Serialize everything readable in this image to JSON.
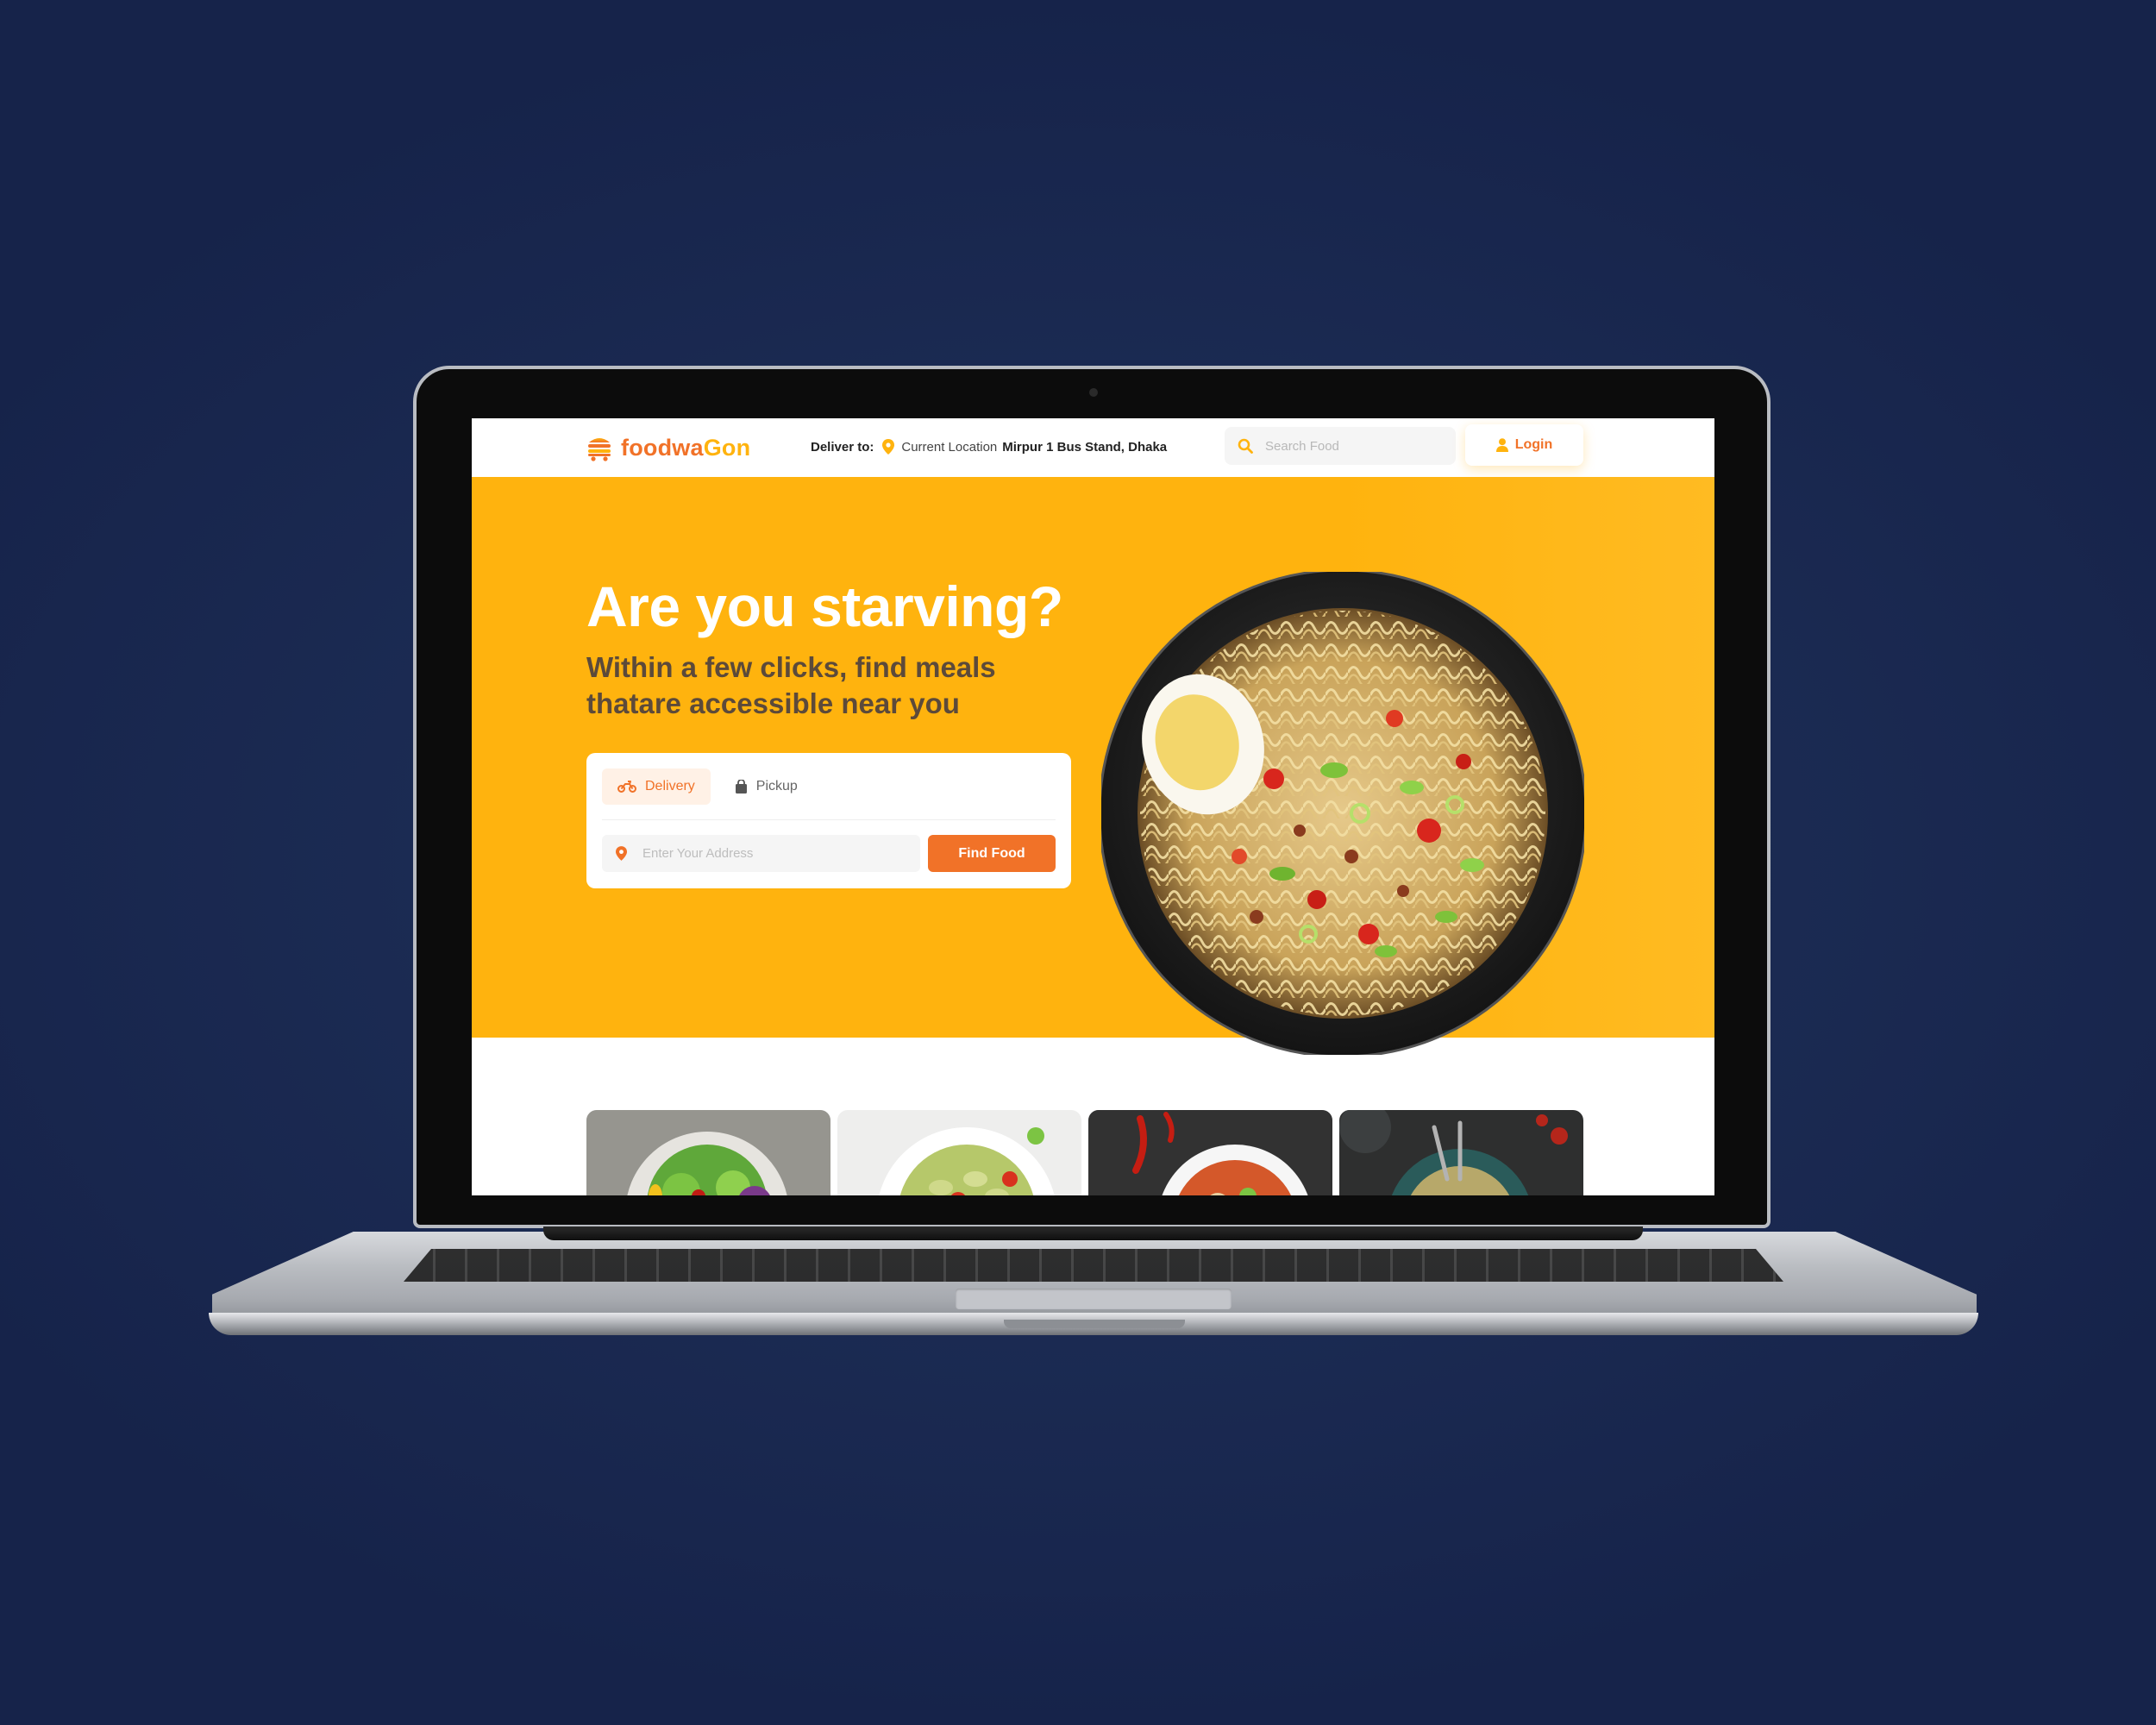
{
  "navbar": {
    "brand_part1": "foodwa",
    "brand_part2": "Gon",
    "deliver_label": "Deliver to:",
    "current_location_label": "Current Location",
    "address": "Mirpur 1 Bus Stand, Dhaka",
    "search_placeholder": "Search Food",
    "login_label": "Login",
    "icons": {
      "logo": "food-truck-icon",
      "location": "map-pin-icon",
      "search": "search-icon",
      "user": "user-icon"
    }
  },
  "hero": {
    "title": "Are you starving?",
    "subtitle": "Within a few clicks, find meals thatare accessible near you",
    "tabs": [
      {
        "label": "Delivery",
        "icon": "motorbike-icon",
        "active": true
      },
      {
        "label": "Pickup",
        "icon": "shopping-bag-icon",
        "active": false
      }
    ],
    "address_placeholder": "Enter Your Address",
    "find_button_label": "Find Food",
    "image": "noodle-bowl-image"
  },
  "food_cards": [
    "salad",
    "pasta-salad",
    "curry-soup",
    "noodle-soup"
  ],
  "colors": {
    "accent_orange": "#F17228",
    "brand_yellow": "#FFB30E",
    "subtitle_brown": "#5C4A3A",
    "background_navy": "#1C2C54"
  }
}
